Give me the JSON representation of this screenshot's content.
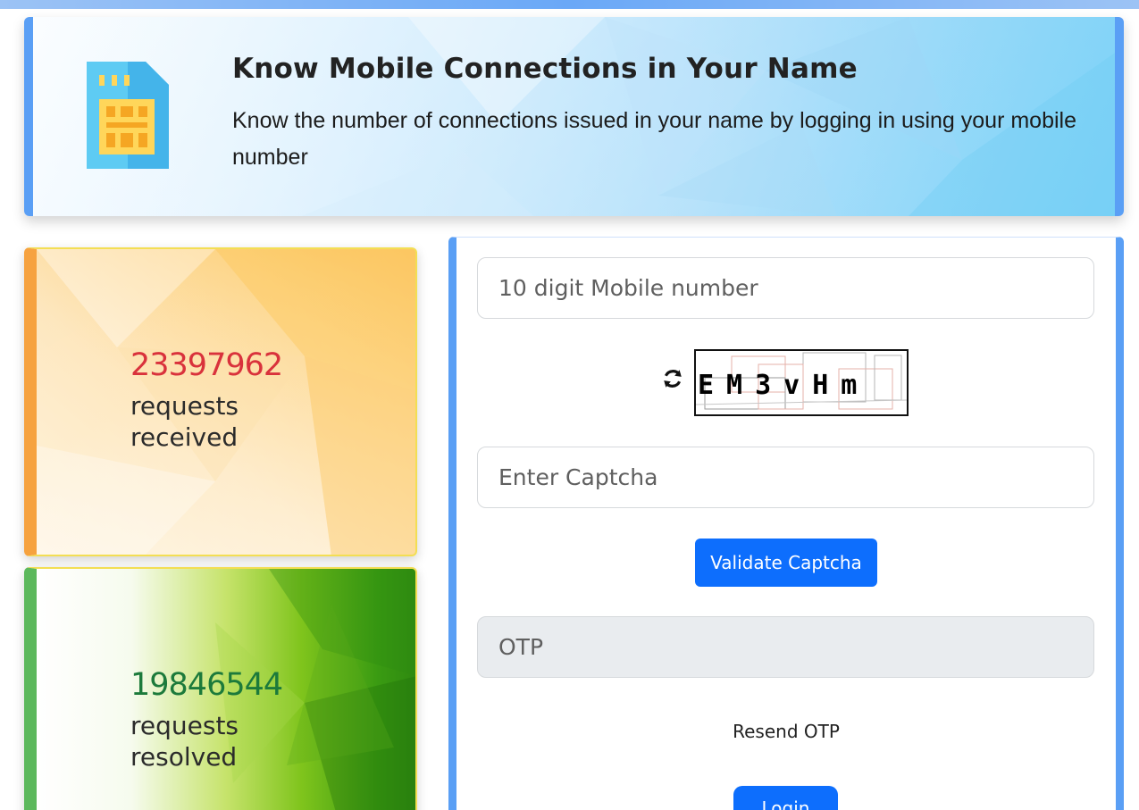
{
  "header": {
    "title": "Know Mobile Connections in Your Name",
    "description": "Know the number of connections issued in your name by logging in using your mobile number",
    "icon": "sim-card-icon"
  },
  "stats": {
    "received": {
      "count": "23397962",
      "label": "requests received",
      "color": "#d9323c"
    },
    "resolved": {
      "count": "19846544",
      "label": "requests resolved",
      "color": "#1c7a3b"
    }
  },
  "form": {
    "mobile_placeholder": "10 digit Mobile number",
    "captcha_text": "EM3vHm",
    "captcha_placeholder": "Enter Captcha",
    "validate_label": "Validate Captcha",
    "otp_placeholder": "OTP",
    "resend_label": "Resend OTP",
    "login_label": "Login"
  },
  "colors": {
    "primary": "#0d6efd",
    "accent_border": "#5a9ff5"
  }
}
